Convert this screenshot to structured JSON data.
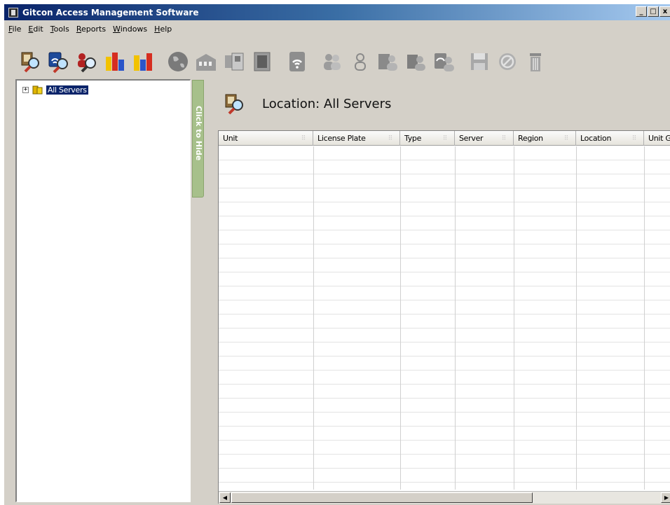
{
  "window": {
    "title": "Gitcon Access Management Software",
    "controls": {
      "minimize": "_",
      "maximize": "□",
      "close": "x"
    }
  },
  "menubar": {
    "items": [
      {
        "label": "File",
        "ul": "F",
        "rest": "ile"
      },
      {
        "label": "Edit",
        "ul": "E",
        "rest": "dit"
      },
      {
        "label": "Tools",
        "ul": "T",
        "rest": "ools"
      },
      {
        "label": "Reports",
        "ul": "R",
        "rest": "eports"
      },
      {
        "label": "Windows",
        "ul": "W",
        "rest": "indows"
      },
      {
        "label": "Help",
        "ul": "H",
        "rest": "elp"
      }
    ]
  },
  "toolbar": {
    "icons": [
      "find-unit-icon",
      "find-wireless-icon",
      "find-user-icon",
      "report-a-icon",
      "report-b-icon",
      "globe-icon",
      "building-icon",
      "device-panel-icon",
      "door-icon",
      "wireless-icon",
      "users-group-icon",
      "user-icon",
      "users-unit-icon",
      "users-edit-icon",
      "users-wireless-icon",
      "save-icon",
      "cancel-icon",
      "trash-icon"
    ]
  },
  "tree": {
    "root_label": "All Servers",
    "expand_glyph": "+"
  },
  "hide_strip": {
    "label": "Click to Hide"
  },
  "location": {
    "text": "Location: All Servers"
  },
  "grid": {
    "columns": [
      "Unit",
      "License Plate",
      "Type",
      "Server",
      "Region",
      "Location",
      "Unit G"
    ],
    "rows": []
  },
  "colors": {
    "titlebar_start": "#0a246a",
    "titlebar_end": "#a6caf0",
    "window_bg": "#d4d0c8",
    "selection": "#0a246a",
    "hide_strip": "#a7c08b"
  }
}
